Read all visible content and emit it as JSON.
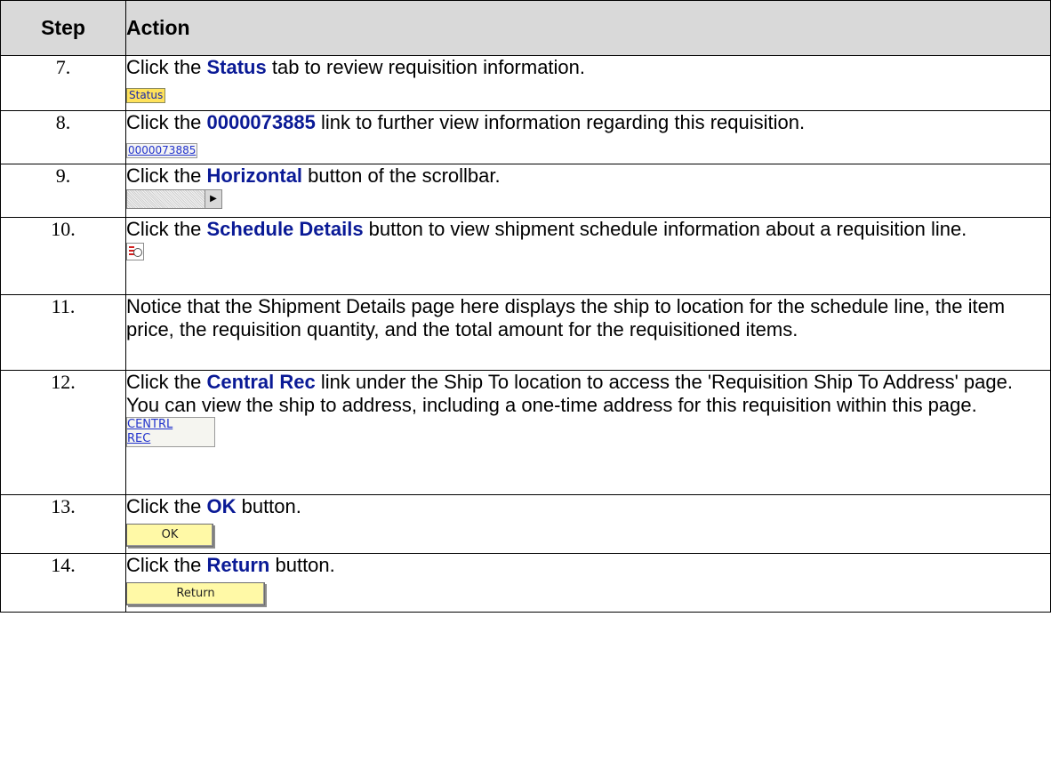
{
  "header": {
    "step": "Step",
    "action": "Action"
  },
  "rows": [
    {
      "num": "7.",
      "pre": "Click the ",
      "hl": "Status",
      "post": " tab to review requisition information.",
      "image_text": "Status"
    },
    {
      "num": "8.",
      "pre": "Click the ",
      "hl": "0000073885",
      "post": " link to further view information regarding this requisition.",
      "image_text": "0000073885"
    },
    {
      "num": "9.",
      "pre": "Click the ",
      "hl": "Horizontal",
      "post": " button of the scrollbar."
    },
    {
      "num": "10.",
      "pre": "Click the ",
      "hl": "Schedule Details",
      "post": " button to view shipment schedule information about a requisition line."
    },
    {
      "num": "11.",
      "text": "Notice that the Shipment Details page here displays the ship to location for the schedule line, the item price, the requisition quantity, and the total amount for the requisitioned items."
    },
    {
      "num": "12.",
      "pre": "Click the ",
      "hl": "Central Rec",
      "post": " link under the Ship To location to access the 'Requisition Ship To Address' page. You can view the ship to address, including a one-time address for this requisition within this page.",
      "image_line1": "CENTRL",
      "image_line2": "REC"
    },
    {
      "num": "13.",
      "pre": "Click the ",
      "hl": "OK",
      "post": " button.",
      "image_text": "OK"
    },
    {
      "num": "14.",
      "pre": "Click the ",
      "hl": "Return",
      "post": " button.",
      "image_text": "Return"
    }
  ],
  "icons": {
    "scroll_arrow": "right-arrow-icon",
    "schedule": "schedule-details-icon"
  },
  "colors": {
    "header_bg": "#d9d9d9",
    "highlight": "#0a1a96",
    "button_yellow": "#fff9a6"
  }
}
